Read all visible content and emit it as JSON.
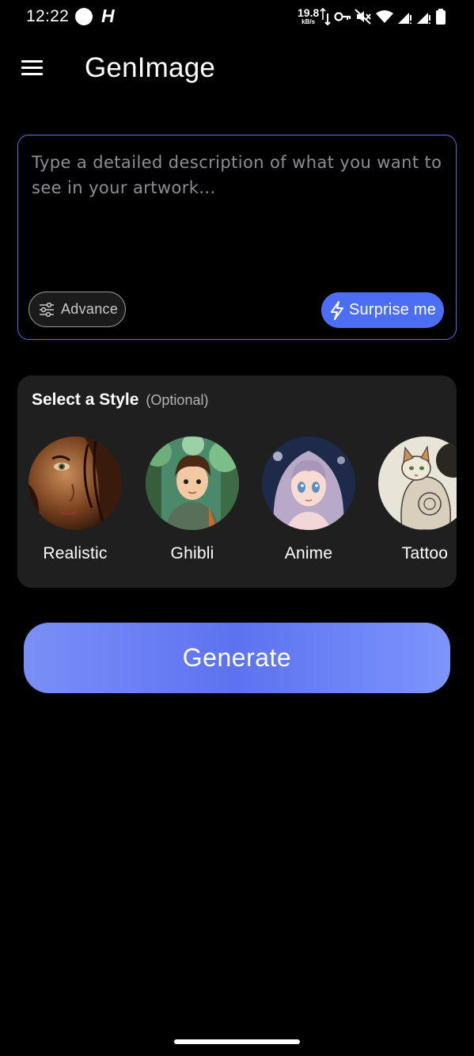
{
  "status_bar": {
    "time": "12:22",
    "carrier_glyph": "H",
    "speed_value": "19.8",
    "speed_unit": "kB/s",
    "icons": [
      "data-arrows-icon",
      "vpn-key-icon",
      "mute-icon",
      "wifi-icon",
      "signal-icon",
      "signal-icon",
      "battery-icon"
    ]
  },
  "app_bar": {
    "title": "GenImage",
    "menu_icon": "hamburger-menu-icon"
  },
  "prompt": {
    "placeholder": "Type a detailed description of what you want to see in your artwork...",
    "value": "",
    "advance_label": "Advance",
    "advance_icon": "sliders-icon",
    "surprise_label": "Surprise me",
    "surprise_icon": "lightning-bolt-icon",
    "accent_color": "#5b6cf0"
  },
  "style_section": {
    "title": "Select a Style",
    "optional_label": "(Optional)",
    "styles": [
      {
        "label": "Realistic"
      },
      {
        "label": "Ghibli"
      },
      {
        "label": "Anime"
      },
      {
        "label": "Tattoo"
      }
    ]
  },
  "generate": {
    "label": "Generate",
    "gradient": [
      "#7b8ff7",
      "#5d72f0",
      "#7d95fb"
    ]
  },
  "colors": {
    "background": "#000000",
    "card": "#1f1f1f",
    "primary": "#4c6ef5"
  }
}
